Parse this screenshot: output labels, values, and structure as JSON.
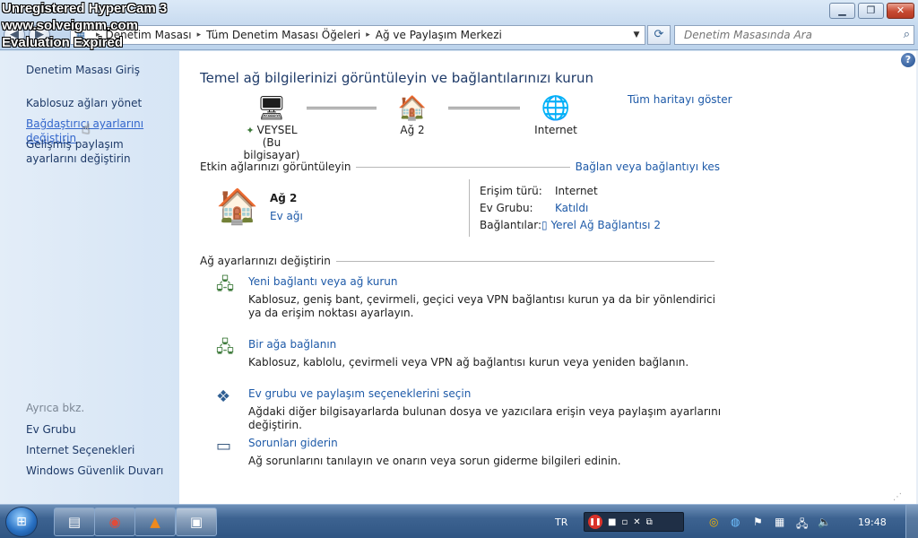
{
  "watermark": {
    "line1": "Unregistered HyperCam 3",
    "line2": "www.solveigmm.com",
    "line3": "Evaluation Expired"
  },
  "window_buttons": {
    "minimize": "▁",
    "maximize": "❐",
    "close": "✕"
  },
  "address": {
    "crumbs": [
      "Denetim Masası",
      "Tüm Denetim Masası Öğeleri",
      "Ağ ve Paylaşım Merkezi"
    ],
    "separator": "▸"
  },
  "search": {
    "placeholder": "Denetim Masasında Ara"
  },
  "sidebar": {
    "home": "Denetim Masası Giriş",
    "wireless": "Kablosuz ağları yönet",
    "adapter": "Bağdaştırıcı ayarlarını değiştirin",
    "advanced": "Gelişmiş paylaşım ayarlarını değiştirin",
    "see_also": "Ayrıca bkz.",
    "homegroup": "Ev Grubu",
    "internet_options": "Internet Seçenekleri",
    "firewall": "Windows Güvenlik Duvarı"
  },
  "main": {
    "title": "Temel ağ bilgilerinizi görüntüleyin ve bağlantılarınızı kurun",
    "full_map": "Tüm haritayı göster",
    "map": {
      "pc_name": "VEYSEL",
      "pc_sub": "(Bu bilgisayar)",
      "network": "Ağ 2",
      "internet": "Internet"
    },
    "active": {
      "heading": "Etkin ağlarınızı görüntüleyin",
      "action": "Bağlan veya bağlantıyı kes",
      "name": "Ağ 2",
      "type": "Ev ağı",
      "access_label": "Erişim türü:",
      "access_value": "Internet",
      "homegroup_label": "Ev Grubu:",
      "homegroup_value": "Katıldı",
      "conn_label": "Bağlantılar:",
      "conn_value": "Yerel Ağ Bağlantısı 2"
    },
    "settings": {
      "heading": "Ağ ayarlarınızı değiştirin",
      "tasks": [
        {
          "link": "Yeni bağlantı veya ağ kurun",
          "desc": "Kablosuz, geniş bant, çevirmeli, geçici veya VPN bağlantısı kurun ya da bir yönlendirici ya da erişim noktası ayarlayın."
        },
        {
          "link": "Bir ağa bağlanın",
          "desc": "Kablosuz, kablolu, çevirmeli veya VPN ağ bağlantısı kurun veya yeniden bağlanın."
        },
        {
          "link": "Ev grubu ve paylaşım seçeneklerini seçin",
          "desc": "Ağdaki diğer bilgisayarlarda bulunan dosya ve yazıcılara erişin veya paylaşım ayarlarını değiştirin."
        },
        {
          "link": "Sorunları giderin",
          "desc": "Ağ sorunlarını tanılayın ve onarın veya sorun giderme bilgileri edinin."
        }
      ]
    }
  },
  "taskbar": {
    "language": "TR",
    "clock": "19:48"
  }
}
